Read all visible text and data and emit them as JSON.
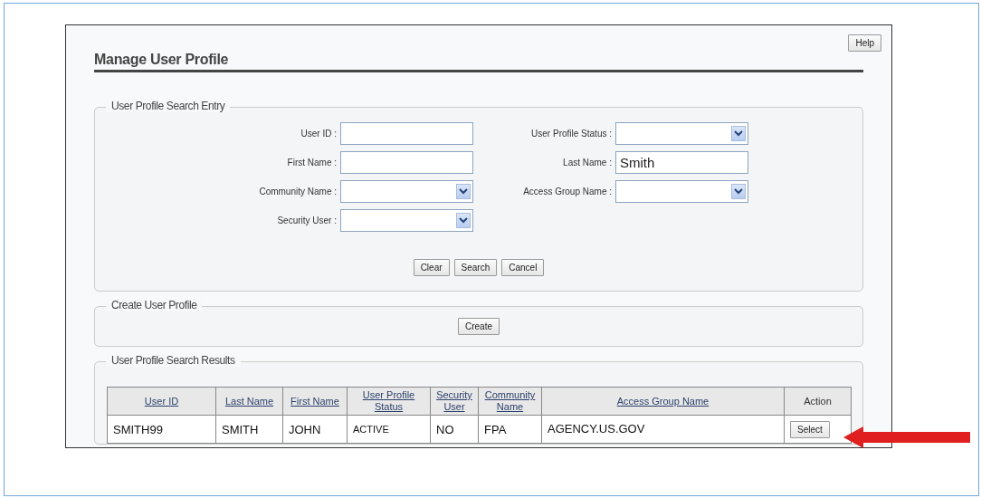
{
  "help_button": "Help",
  "title": "Manage User Profile",
  "search_entry": {
    "legend": "User Profile Search Entry",
    "fields": [
      {
        "label": "User ID :",
        "kind": "text"
      },
      {
        "label": "User Profile Status :",
        "kind": "select"
      },
      {
        "label": "First Name :",
        "kind": "text"
      },
      {
        "label": "Last Name :",
        "kind": "text",
        "value": "Smith"
      },
      {
        "label": "Community Name :",
        "kind": "select"
      },
      {
        "label": "Access Group Name :",
        "kind": "select"
      },
      {
        "label": "Security User :",
        "kind": "select"
      }
    ],
    "buttons": [
      "Clear",
      "Search",
      "Cancel"
    ]
  },
  "create": {
    "legend": "Create User Profile",
    "button": "Create"
  },
  "results": {
    "legend": "User Profile Search Results",
    "columns": [
      {
        "label": "User ID",
        "sortable": true
      },
      {
        "label": "Last Name",
        "sortable": true
      },
      {
        "label": "First Name",
        "sortable": true
      },
      {
        "label": "User Profile Status",
        "sortable": true
      },
      {
        "label": "Security User",
        "sortable": true
      },
      {
        "label": "Community Name",
        "sortable": true
      },
      {
        "label": "Access Group Name",
        "sortable": true
      },
      {
        "label": "Action",
        "sortable": false
      }
    ],
    "rows": [
      {
        "cells": [
          "SMITH99",
          "SMITH",
          "JOHN",
          "ACTIVE",
          "NO",
          "FPA",
          "AGENCY.US.GOV"
        ],
        "action": "Select"
      }
    ]
  }
}
